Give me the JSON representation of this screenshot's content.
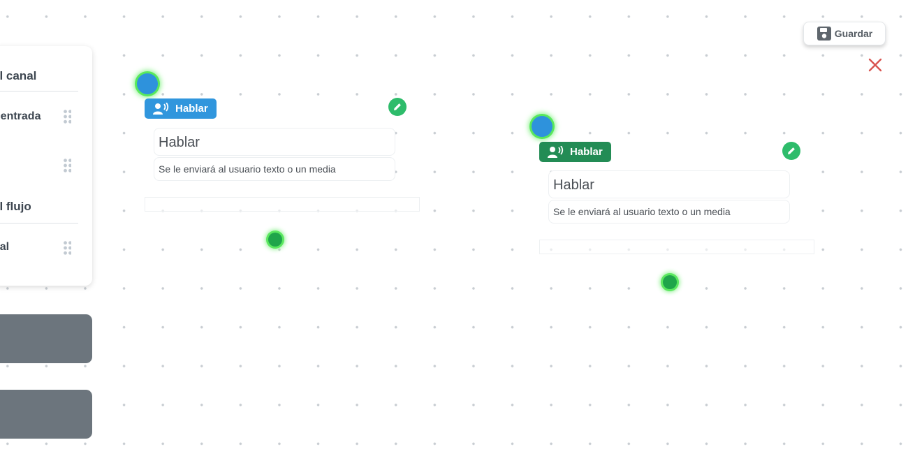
{
  "toolbar": {
    "save_label": "Guardar",
    "save_icon": "floppy-disk-icon",
    "close_icon": "close-icon"
  },
  "palette": {
    "sections": [
      {
        "title": "el canal",
        "items": [
          {
            "label": "r entrada"
          },
          {
            "label": ""
          }
        ]
      },
      {
        "title": "el flujo",
        "items": [
          {
            "label": "nal"
          }
        ]
      }
    ]
  },
  "nodes": [
    {
      "badge_label": "Hablar",
      "badge_color": "#3096dd",
      "icon": "speaking-person-icon",
      "title": "Hablar",
      "description": "Se le enviará al usuario texto o un media"
    },
    {
      "badge_label": "Hablar",
      "badge_color": "#238c55",
      "icon": "speaking-person-icon",
      "title": "Hablar",
      "description": "Se le enviará al usuario texto o un media"
    }
  ],
  "colors": {
    "accent_blue": "#3096dd",
    "accent_green": "#238c55",
    "edit_green": "#2ebc6b",
    "close_red": "#d9534f",
    "panel_grey": "#6c757d"
  }
}
